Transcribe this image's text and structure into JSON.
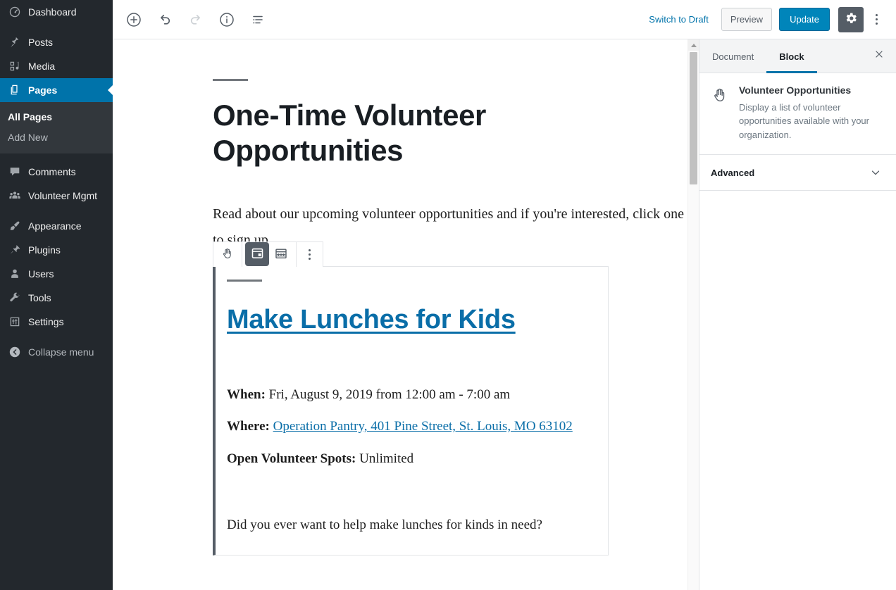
{
  "admin_menu": {
    "items": [
      {
        "label": "Dashboard",
        "icon": "dashboard-icon",
        "current": false
      },
      {
        "label": "Posts",
        "icon": "pin-icon",
        "current": false
      },
      {
        "label": "Media",
        "icon": "media-icon",
        "current": false
      },
      {
        "label": "Pages",
        "icon": "pages-icon",
        "current": true
      },
      {
        "label": "Comments",
        "icon": "comment-icon",
        "current": false
      },
      {
        "label": "Volunteer Mgmt",
        "icon": "group-icon",
        "current": false
      },
      {
        "label": "Appearance",
        "icon": "brush-icon",
        "current": false
      },
      {
        "label": "Plugins",
        "icon": "plugin-icon",
        "current": false
      },
      {
        "label": "Users",
        "icon": "user-icon",
        "current": false
      },
      {
        "label": "Tools",
        "icon": "wrench-icon",
        "current": false
      },
      {
        "label": "Settings",
        "icon": "settings-icon",
        "current": false
      }
    ],
    "submenu": [
      {
        "label": "All Pages",
        "current": true
      },
      {
        "label": "Add New",
        "current": false
      }
    ],
    "collapse_label": "Collapse menu",
    "collapse_icon": "collapse-arrow-icon",
    "highlight_color": "#0073aa"
  },
  "header": {
    "tools": [
      {
        "name": "add-block-button",
        "icon": "plus-circle-icon",
        "disabled": false
      },
      {
        "name": "undo-button",
        "icon": "undo-icon",
        "disabled": false
      },
      {
        "name": "redo-button",
        "icon": "redo-icon",
        "disabled": true
      },
      {
        "name": "content-info-button",
        "icon": "info-circle-icon",
        "disabled": false
      },
      {
        "name": "block-navigation-button",
        "icon": "list-view-icon",
        "disabled": false
      }
    ],
    "switch_to_draft_label": "Switch to Draft",
    "preview_label": "Preview",
    "update_label": "Update",
    "settings_icon": "gear-icon",
    "more_menu_icon": "ellipsis-vertical-icon",
    "update_color": "#0085ba",
    "link_color": "#0073aa"
  },
  "editor": {
    "post_title": "One-Time Volunteer Opportunities",
    "intro_paragraph": "Read about our upcoming volunteer opportunities and if you're interested, click one to sign up.",
    "block_toolbar": {
      "drag_icon": "hand-icon",
      "list_view_icon": "calendar-list-icon",
      "calendar_view_icon": "calendar-grid-icon",
      "more_options_icon": "ellipsis-vertical-icon",
      "active_view": "calendar-list-icon"
    },
    "opportunity": {
      "title": "Make Lunches for Kids",
      "when_label": "When:",
      "when_value": "Fri, August 9, 2019 from 12:00 am - 7:00 am",
      "where_label": "Where:",
      "where_value": "Operation Pantry, 401 Pine Street, St. Louis, MO 63102",
      "spots_label": "Open Volunteer Spots:",
      "spots_value": "Unlimited",
      "description": "Did you ever want to help make lunches for kinds in need?",
      "link_color": "#0a6ea8"
    }
  },
  "sidebar": {
    "tabs": [
      {
        "label": "Document",
        "active": false
      },
      {
        "label": "Block",
        "active": true
      }
    ],
    "close_icon": "close-icon",
    "block_card": {
      "icon": "hand-icon",
      "title": "Volunteer Opportunities",
      "description": "Display a list of volunteer opportunities available with your organization."
    },
    "panels": [
      {
        "label": "Advanced",
        "icon": "chevron-down-icon",
        "expanded": false
      }
    ],
    "active_tab_color": "#0073aa"
  },
  "scrollbar": {
    "up_arrow_icon": "triangle-up-icon"
  }
}
